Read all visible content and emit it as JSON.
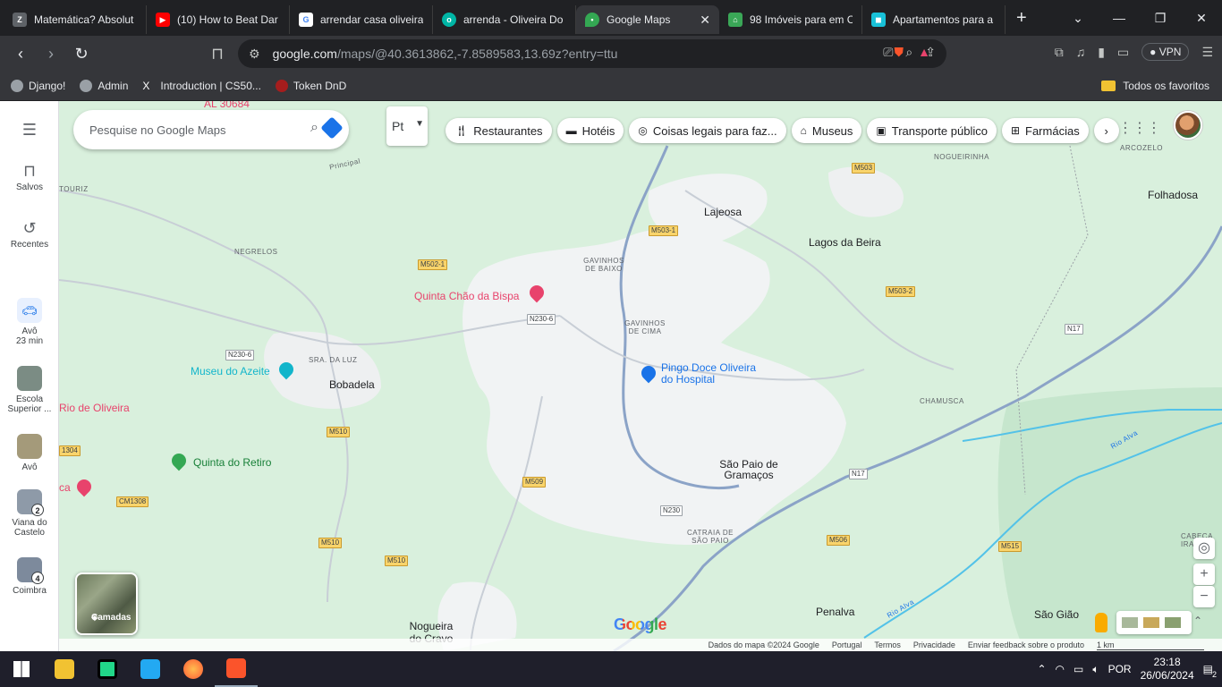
{
  "browser": {
    "tabs": [
      {
        "title": "Matemática? Absolut",
        "color": "#5f6368"
      },
      {
        "title": "(10) How to Beat Dar",
        "color": "#ff0000"
      },
      {
        "title": "arrendar casa oliveira",
        "color": "#4285f4"
      },
      {
        "title": "arrenda - Oliveira Do",
        "color": "#00b5a5"
      },
      {
        "title": "Google Maps",
        "color": "#34a853",
        "active": true
      },
      {
        "title": "98 Imóveis para em C",
        "color": "#3aa757"
      },
      {
        "title": "Apartamentos para a",
        "color": "#18c1d8"
      }
    ],
    "url_domain": "google.com",
    "url_path": "/maps/@40.3613862,-7.8589583,13.69z?entry=ttu",
    "vpn_label": "VPN",
    "brave_badge": "3",
    "bookmarks": [
      "Django!",
      "Admin",
      "Introduction | CS50...",
      "Token DnD"
    ],
    "bookmarks_all": "Todos os favoritos"
  },
  "sidebar": {
    "saved": "Salvos",
    "recent": "Recentes",
    "recents": [
      {
        "label": "Avô",
        "sub": "23 min"
      },
      {
        "label": "Escola",
        "sub": "Superior ..."
      },
      {
        "label": "Avô",
        "sub": ""
      },
      {
        "label": "Viana do",
        "sub": "Castelo",
        "badge": "2"
      },
      {
        "label": "Coimbra",
        "sub": "",
        "badge": "4"
      }
    ]
  },
  "map": {
    "search_placeholder": "Pesquise no Google Maps",
    "pt_label": "Pt",
    "chips": [
      "Restaurantes",
      "Hotéis",
      "Coisas legais para faz...",
      "Museus",
      "Transporte público",
      "Farmácias"
    ],
    "layers_label": "Camadas",
    "google_logo": "Google",
    "attribution": [
      "Dados do mapa ©2024 Google",
      "Portugal",
      "Termos",
      "Privacidade",
      "Enviar feedback sobre o produto",
      "1 km"
    ],
    "labels": {
      "arcozelo": "ARCOZELO",
      "folhadosa": "Folhadosa",
      "nogueirinha": "NOGUEIRINHA",
      "lajeosa": "Lajeosa",
      "lagos": "Lagos da Beira",
      "gavinhos_baixo": "GAVINHOS DE BAIXO",
      "gavinhos_cima": "GAVINHOS DE CIMA",
      "negrelos": "NEGRELOS",
      "touriz": "TOURIZ",
      "principal": "Principal",
      "sra_luz": "SRA. DA LUZ",
      "bobadela": "Bobadela",
      "chamusca": "CHAMUSCA",
      "sao_paio": "São Paio de Gramaços",
      "catraia": "CATRAIA DE SÃO PAIO",
      "nogueira": "Nogueira do Cravo",
      "penalva": "Penalva",
      "sao_giao": "São Gião",
      "careca": "CABEÇA IRA",
      "rio_alva": "Rio Alva",
      "rio_alva2": "Rio Alva"
    },
    "pois": {
      "quinta_chao": "Quinta Chão da Bispa",
      "museu_azeite": "Museu do Azeite",
      "rio_oliveira": "Rio de Oliveira",
      "quinta_retiro": "Quinta do Retiro",
      "pingo_doce": "Pingo Doce Oliveira do Hospital",
      "al": "AL 30684",
      "ca": "ca"
    },
    "roads": [
      "M503",
      "M503-1",
      "M502-1",
      "M503-2",
      "N17",
      "N230-6",
      "N230-6",
      "M510",
      "M509",
      "N230",
      "M506",
      "M515",
      "CM1308",
      "M510",
      "M510",
      "1304",
      "N17"
    ]
  },
  "taskbar": {
    "lang": "POR",
    "time": "23:18",
    "date": "26/06/2024",
    "notif": "2"
  }
}
